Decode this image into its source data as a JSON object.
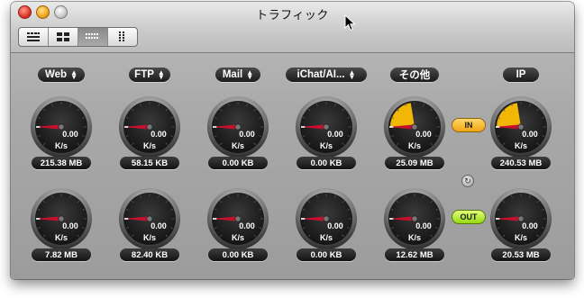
{
  "window": {
    "title": "トラフィック"
  },
  "view_modes": [
    {
      "name": "view-mode-large-grid-icon",
      "active": false
    },
    {
      "name": "view-mode-two-column-icon",
      "active": false
    },
    {
      "name": "view-mode-small-grid-icon",
      "active": true
    },
    {
      "name": "view-mode-list-icon",
      "active": false
    }
  ],
  "columns": [
    {
      "key": "web",
      "label": "Web",
      "has_menu": true,
      "in": {
        "speed": "0.00",
        "unit": "K/s",
        "total": "215.38 MB",
        "fill": 0
      },
      "out": {
        "speed": "0.00",
        "unit": "K/s",
        "total": "7.82 MB",
        "fill": 0
      }
    },
    {
      "key": "ftp",
      "label": "FTP",
      "has_menu": true,
      "in": {
        "speed": "0.00",
        "unit": "K/s",
        "total": "58.15 KB",
        "fill": 0
      },
      "out": {
        "speed": "0.00",
        "unit": "K/s",
        "total": "82.40 KB",
        "fill": 0
      }
    },
    {
      "key": "mail",
      "label": "Mail",
      "has_menu": true,
      "in": {
        "speed": "0.00",
        "unit": "K/s",
        "total": "0.00 KB",
        "fill": 0
      },
      "out": {
        "speed": "0.00",
        "unit": "K/s",
        "total": "0.00 KB",
        "fill": 0
      }
    },
    {
      "key": "ichat",
      "label": "iChat/AI...",
      "has_menu": true,
      "in": {
        "speed": "0.00",
        "unit": "K/s",
        "total": "0.00 KB",
        "fill": 0
      },
      "out": {
        "speed": "0.00",
        "unit": "K/s",
        "total": "0.00 KB",
        "fill": 0
      }
    },
    {
      "key": "other",
      "label": "その他",
      "has_menu": false,
      "in": {
        "speed": "0.00",
        "unit": "K/s",
        "total": "25.09 MB",
        "fill": 0.3
      },
      "out": {
        "speed": "0.00",
        "unit": "K/s",
        "total": "12.62 MB",
        "fill": 0
      }
    },
    {
      "key": "ip",
      "label": "IP",
      "has_menu": false,
      "in": {
        "speed": "0.00",
        "unit": "K/s",
        "total": "240.53 MB",
        "fill": 0.3
      },
      "out": {
        "speed": "0.00",
        "unit": "K/s",
        "total": "20.53 MB",
        "fill": 0
      }
    }
  ],
  "direction": {
    "in_label": "IN",
    "out_label": "OUT"
  },
  "colors": {
    "needle": "#c8102e",
    "gauge_fill": "#f2b705",
    "in_pill": "#f1a512",
    "out_pill": "#9ad61a"
  },
  "icons": {
    "reset": "reset-icon",
    "cursor": "pointer-cursor-icon"
  }
}
